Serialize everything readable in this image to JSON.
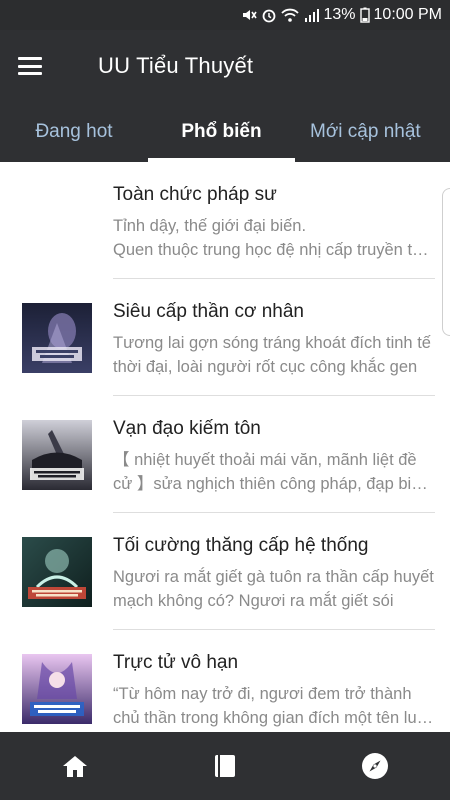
{
  "status_bar": {
    "battery": "13%",
    "time": "10:00 PM"
  },
  "app_bar": {
    "title": "UU Tiểu Thuyết"
  },
  "tabs": [
    {
      "label": "Đang hot",
      "active": false
    },
    {
      "label": "Phổ biến",
      "active": true
    },
    {
      "label": "Mới cập nhật",
      "active": false
    }
  ],
  "books": [
    {
      "title": "Toàn chức pháp sư",
      "description": "Tỉnh dậy, thế giới đại biến.\nQuen thuộc trung học đệ nhị cấp truyền thụ chính là ma pháp",
      "cover_colors": [
        "#ffffff",
        "#ffffff"
      ]
    },
    {
      "title": "Siêu cấp thần cơ nhân",
      "description": "Tương lai gợn sóng tráng khoát đích tinh tế thời đại, loài người rốt cục công khắc gen",
      "cover_colors": [
        "#2b2f4a",
        "#8a7fb0"
      ]
    },
    {
      "title": "Vạn đạo kiếm tôn",
      "description": "【 nhiệt huyết thoải mái văn, mãnh liệt đề cử 】sửa nghịch thiên công pháp, đạp biến vạn giới",
      "cover_colors": [
        "#3a3a44",
        "#b9b9c6"
      ]
    },
    {
      "title": "Tối cường thăng cấp hệ thống",
      "description": "Ngươi ra mắt giết gà tuôn ra thần cấp huyết mạch không có? Ngươi ra mắt giết sói",
      "cover_colors": [
        "#1f3b3a",
        "#7fa9a0"
      ]
    },
    {
      "title": "Trực tử vô hạn",
      "description": "“Từ hôm nay trở đi, ngươi đem trở thành chủ thần trong không gian đích một tên luân hồi giả",
      "cover_colors": [
        "#3b2b6a",
        "#d9a7e0"
      ]
    }
  ],
  "bottom_nav": [
    {
      "icon": "home-icon"
    },
    {
      "icon": "book-icon"
    },
    {
      "icon": "compass-icon"
    }
  ]
}
